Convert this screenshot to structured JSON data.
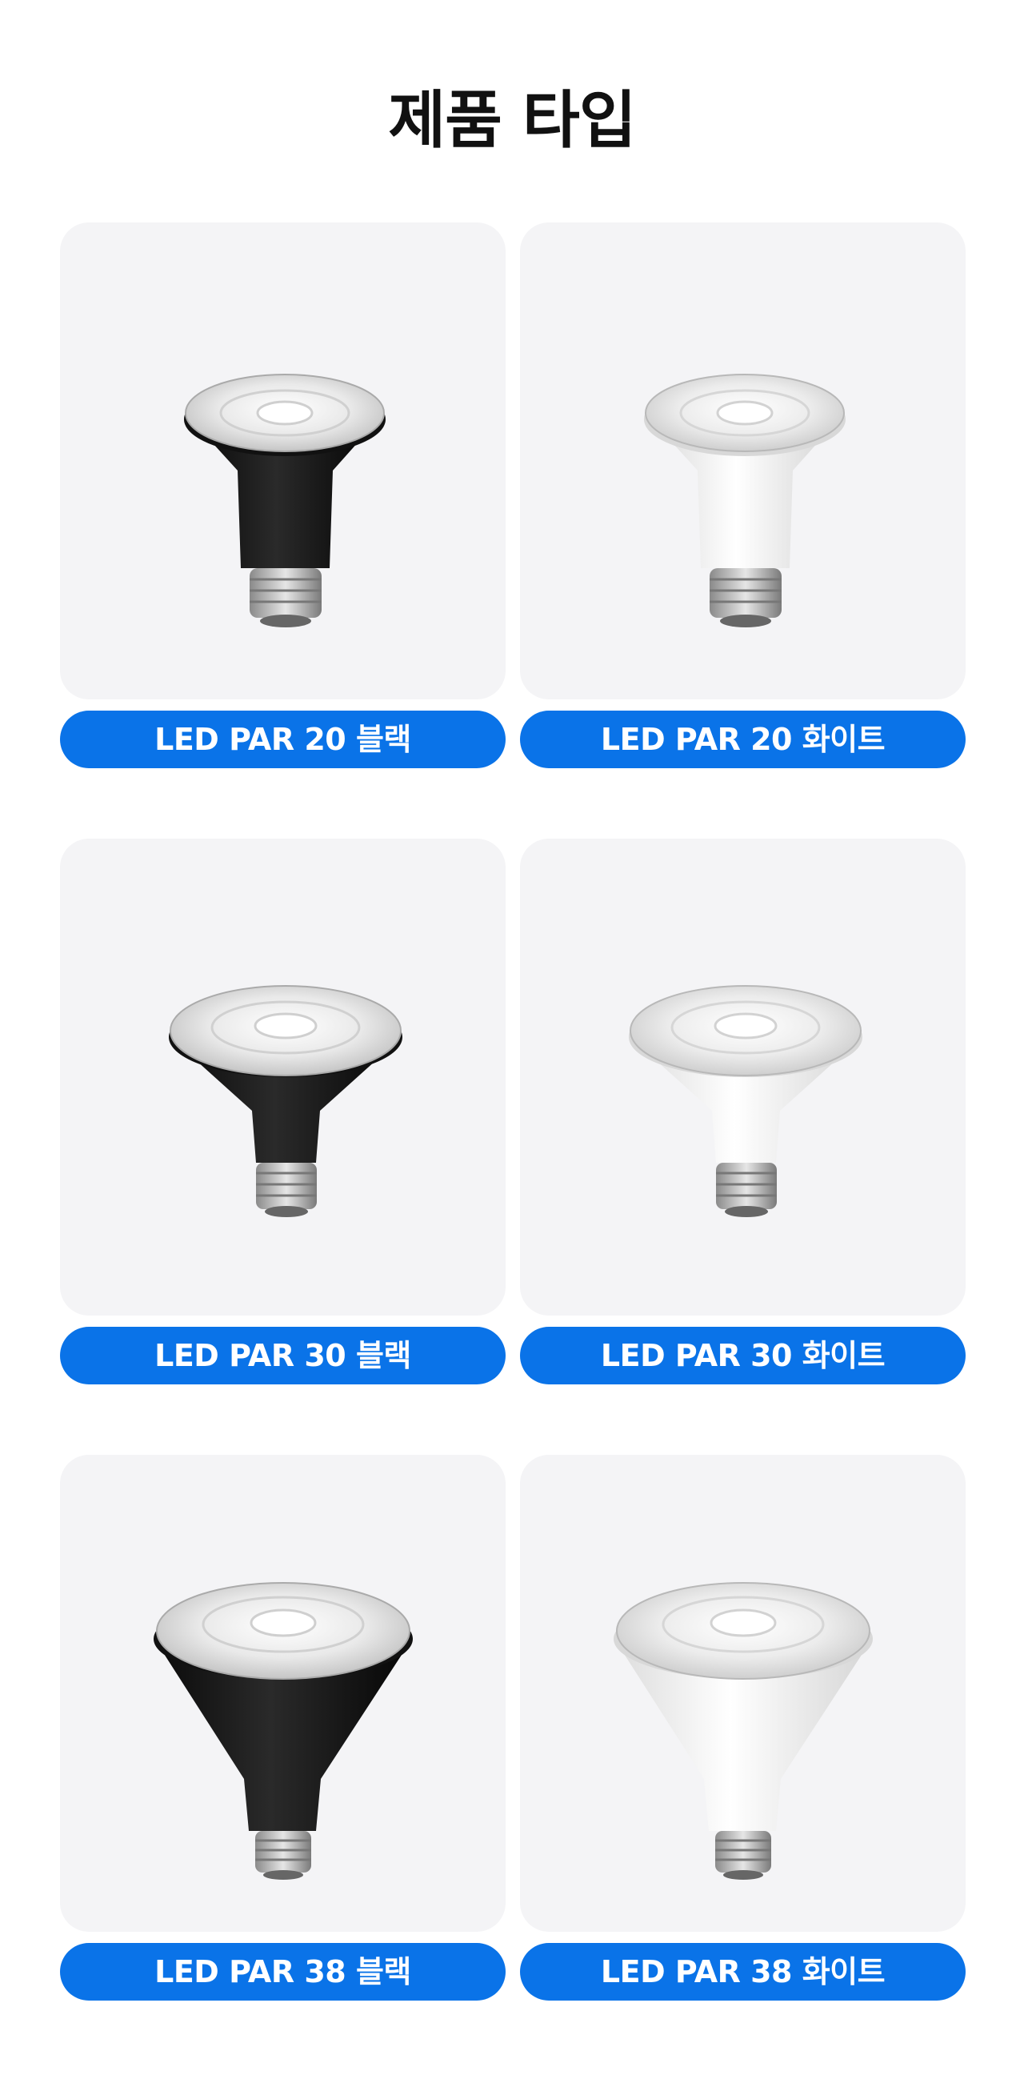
{
  "page": {
    "title": "제품 타입"
  },
  "products": [
    {
      "label": "LED PAR 20 블랙",
      "size": "PAR20",
      "color": "black"
    },
    {
      "label": "LED PAR 20 화이트",
      "size": "PAR20",
      "color": "white"
    },
    {
      "label": "LED PAR 30 블랙",
      "size": "PAR30",
      "color": "black"
    },
    {
      "label": "LED PAR 30 화이트",
      "size": "PAR30",
      "color": "white"
    },
    {
      "label": "LED PAR 38 블랙",
      "size": "PAR38",
      "color": "black"
    },
    {
      "label": "LED PAR 38 화이트",
      "size": "PAR38",
      "color": "white"
    }
  ],
  "colors": {
    "accent": "#0a73e8",
    "card_background": "#f4f4f6",
    "title_text": "#111111"
  },
  "icons": {
    "product_image": "led-par-bulb-icon"
  }
}
